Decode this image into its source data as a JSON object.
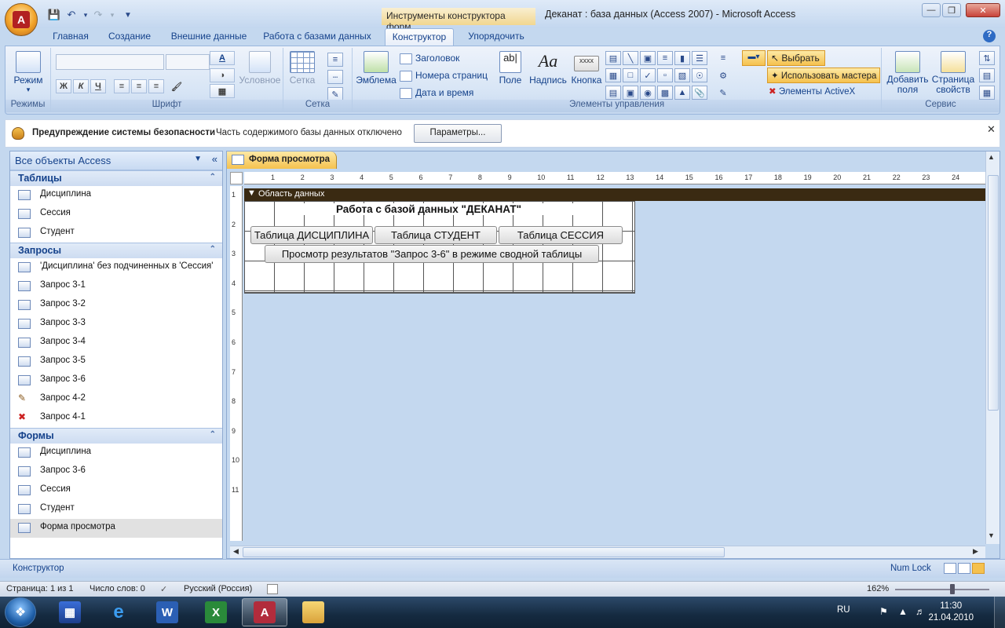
{
  "titlebar": {
    "context_tab": "Инструменты конструктора форм",
    "window_title": "Деканат : база данных (Access 2007) - Microsoft Access"
  },
  "ribbon_tabs": [
    "Главная",
    "Создание",
    "Внешние данные",
    "Работа с базами данных",
    "Конструктор",
    "Упорядочить"
  ],
  "ribbon": {
    "modes": {
      "view_label": "Режим",
      "group": "Режимы"
    },
    "font": {
      "group": "Шрифт",
      "conditional": "Условное"
    },
    "grid": {
      "label": "Сетка",
      "group": "Сетка"
    },
    "controls": {
      "group": "Элементы управления",
      "logo": "Эмблема",
      "heading": "Заголовок",
      "page_numbers": "Номера страниц",
      "date_time": "Дата и время",
      "field": "Поле",
      "label": "Надпись",
      "button": "Кнопка",
      "button_icon_text": "xxxx",
      "select": "Выбрать",
      "use_wizards": "Использовать мастера",
      "activex": "Элементы ActiveX"
    },
    "tools": {
      "group": "Сервис",
      "add_fields": "Добавить поля",
      "property_sheet": "Страница свойств"
    }
  },
  "security": {
    "title": "Предупреждение системы безопасности",
    "message": "Часть содержимого базы данных отключено",
    "button": "Параметры..."
  },
  "nav": {
    "header": "Все объекты Access",
    "sections": [
      {
        "title": "Таблицы",
        "items": [
          "Дисциплина",
          "Сессия",
          "Студент"
        ]
      },
      {
        "title": "Запросы",
        "items": [
          "'Дисциплина' без подчиненных в 'Сессия'",
          "Запрос 3-1",
          "Запрос 3-2",
          "Запрос 3-3",
          "Запрос 3-4",
          "Запрос 3-5",
          "Запрос 3-6",
          "Запрос 4-2",
          "Запрос 4-1"
        ]
      },
      {
        "title": "Формы",
        "items": [
          "Дисциплина",
          "Запрос 3-6",
          "Сессия",
          "Студент",
          "Форма просмотра"
        ]
      }
    ]
  },
  "document": {
    "tab": "Форма просмотра",
    "section": "Область данных",
    "form_title": "Работа с базой данных \"ДЕКАНАТ\"",
    "buttons": [
      "Таблица ДИСЦИПЛИНА",
      "Таблица СТУДЕНТ",
      "Таблица СЕССИЯ"
    ],
    "wide_button": "Просмотр результатов \"Запрос  3-6\" в режиме сводной таблицы",
    "ruler_h": [
      "1",
      "2",
      "3",
      "4",
      "5",
      "6",
      "7",
      "8",
      "9",
      "10",
      "11",
      "12",
      "13",
      "14",
      "15",
      "16",
      "17",
      "18",
      "19",
      "20",
      "21",
      "22",
      "23",
      "24"
    ],
    "ruler_v": [
      "1",
      "2",
      "3",
      "4",
      "5",
      "6",
      "7",
      "8",
      "9",
      "10",
      "11"
    ]
  },
  "statusbar": {
    "left": "Конструктор",
    "numlock": "Num Lock"
  },
  "wordbar": {
    "page": "Страница: 1 из 1",
    "words": "Число слов: 0",
    "lang": "Русский (Россия)",
    "zoom": "162%"
  },
  "taskbar": {
    "lang": "RU",
    "time": "11:30",
    "date": "21.04.2010"
  }
}
